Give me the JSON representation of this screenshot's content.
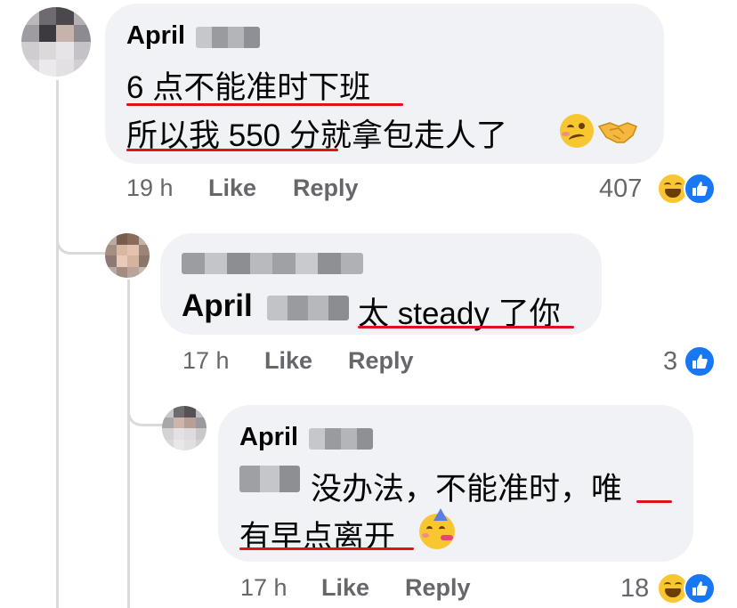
{
  "comments": [
    {
      "author": "April",
      "lines": [
        "6 点不能准时下班",
        "所以我 550 分就拿包走人了"
      ],
      "time": "19 h",
      "like_label": "Like",
      "reply_label": "Reply",
      "reaction_count": "407",
      "reactions": [
        "haha-icon",
        "like-icon"
      ]
    },
    {
      "mention": "April",
      "text": "太 steady 了你",
      "time": "17 h",
      "like_label": "Like",
      "reply_label": "Reply",
      "reaction_count": "3",
      "reactions": [
        "like-icon"
      ]
    },
    {
      "author": "April",
      "lines": [
        "没办法，不能准时，唯",
        "有早点离开"
      ],
      "time": "17 h",
      "like_label": "Like",
      "reply_label": "Reply",
      "reaction_count": "18",
      "reactions": [
        "haha-icon",
        "like-icon"
      ]
    }
  ],
  "colors": {
    "bubble": "#f0f2f5",
    "meta_text": "#65676b",
    "underline": "#e0101d",
    "like_blue": "#1877f2"
  }
}
